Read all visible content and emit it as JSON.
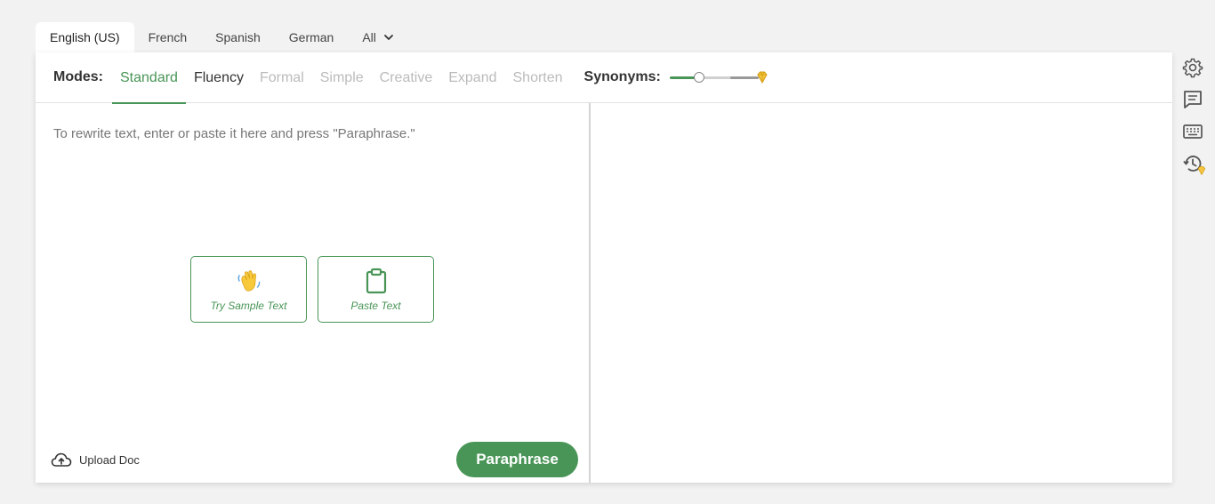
{
  "languages": {
    "tabs": [
      "English (US)",
      "French",
      "Spanish",
      "German",
      "All"
    ],
    "active": "English (US)"
  },
  "modes": {
    "label": "Modes:",
    "items": [
      "Standard",
      "Fluency",
      "Formal",
      "Simple",
      "Creative",
      "Expand",
      "Shorten"
    ],
    "active": "Standard"
  },
  "synonyms": {
    "label": "Synonyms:",
    "level": 0.3
  },
  "input": {
    "placeholder": "To rewrite text, enter or paste it here and press \"Paraphrase.\"",
    "try_sample_label": "Try Sample Text",
    "paste_label": "Paste Text",
    "upload_label": "Upload Doc",
    "paraphrase_label": "Paraphrase"
  },
  "side_icons": [
    "gear-icon",
    "comment-icon",
    "keyboard-icon",
    "history-icon"
  ],
  "colors": {
    "accent": "#499557",
    "premium": "#f0b429"
  }
}
